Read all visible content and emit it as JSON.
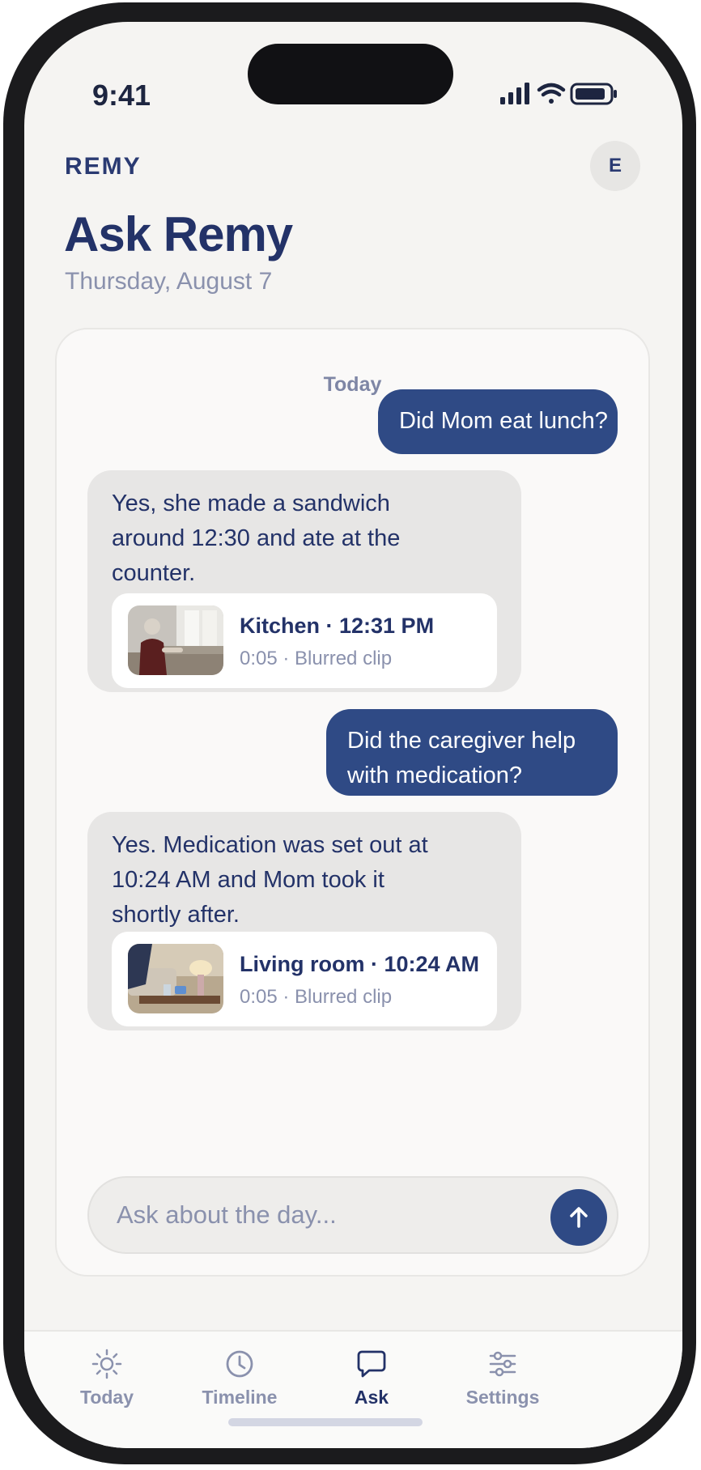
{
  "status_bar": {
    "time": "9:41"
  },
  "header": {
    "brand": "REMY",
    "avatar_initial": "E",
    "title": "Ask Remy",
    "date": "Thursday, August 7"
  },
  "chat": {
    "day_label": "Today",
    "messages": [
      {
        "role": "user",
        "text": "Did Mom eat lunch?"
      },
      {
        "role": "assistant",
        "text": "Yes, she made a sandwich around 12:30 and ate at the counter.",
        "clip": {
          "title": "Kitchen · 12:31 PM",
          "subtitle": "0:05 · Blurred clip"
        }
      },
      {
        "role": "user",
        "text": "Did the caregiver help with medication?"
      },
      {
        "role": "assistant",
        "text": "Yes. Medication was set out at 10:24 AM and Mom took it shortly after.",
        "clip": {
          "title": "Living room · 10:24 AM",
          "subtitle": "0:05 · Blurred clip"
        }
      }
    ]
  },
  "composer": {
    "placeholder": "Ask about the day...",
    "value": ""
  },
  "tabbar": {
    "active": "Ask",
    "items": [
      {
        "label": "Today",
        "icon": "sun-icon"
      },
      {
        "label": "Timeline",
        "icon": "clock-icon"
      },
      {
        "label": "Ask",
        "icon": "chat-bubble-icon"
      },
      {
        "label": "Settings",
        "icon": "sliders-icon"
      }
    ]
  },
  "colors": {
    "primary_navy": "#2f4a85",
    "heading_navy": "#233268",
    "muted_text": "#8a91ad",
    "background": "#f5f4f2",
    "assistant_bubble": "#e7e6e5"
  }
}
